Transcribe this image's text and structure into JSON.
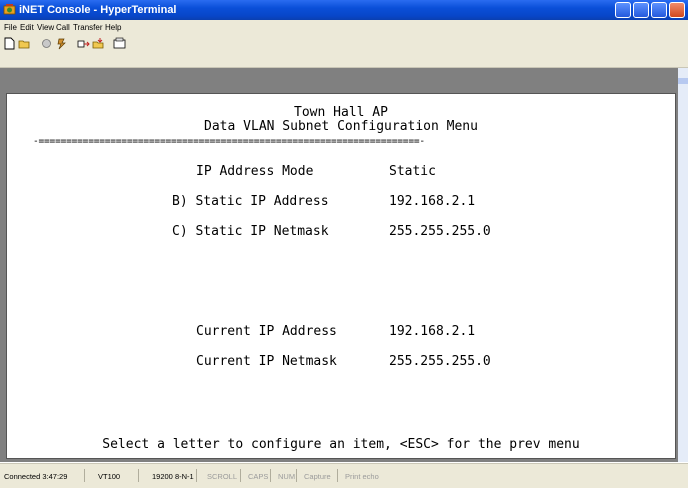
{
  "window": {
    "title": "iNET Console - HyperTerminal"
  },
  "menu": {
    "items": [
      "File",
      "Edit",
      "View",
      "Call",
      "Transfer",
      "Help"
    ]
  },
  "toolbar": {
    "icons": [
      "new-connection-icon",
      "open-icon",
      "disconnect-icon",
      "dial-icon",
      "send-icon",
      "receive-icon",
      "properties-icon"
    ]
  },
  "terminal": {
    "header_line1": "Town Hall AP",
    "header_line2": "Data VLAN Subnet Configuration Menu",
    "divider": "-=====================================================================-",
    "rows": [
      {
        "label": "IP Address Mode",
        "value": "Static"
      },
      {
        "label": "B) Static IP Address",
        "value": "192.168.2.1"
      },
      {
        "label": "C) Static IP Netmask",
        "value": "255.255.255.0"
      },
      {
        "label": "Current IP Address",
        "value": "192.168.2.1"
      },
      {
        "label": "Current IP Netmask",
        "value": "255.255.255.0"
      }
    ],
    "prompt": "Select a letter to configure an item, <ESC> for the prev menu"
  },
  "status": {
    "connected": "Connected 3:47:29",
    "emulation": "VT100",
    "settings": "19200 8-N-1",
    "scroll": "SCROLL",
    "caps": "CAPS",
    "num": "NUM",
    "capture": "Capture",
    "print_echo": "Print echo"
  },
  "colors": {
    "title_bar": "#0a4fd8",
    "chrome": "#ece9d8",
    "terminal_bg": "#ffffff",
    "terminal_text": "#000000",
    "frame": "#808080"
  }
}
